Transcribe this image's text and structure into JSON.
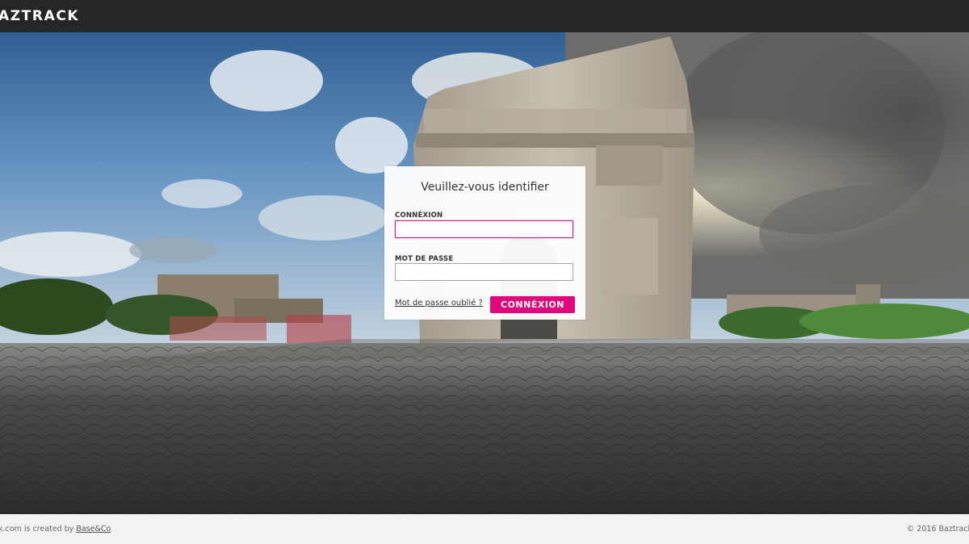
{
  "header": {
    "brand": "AZTRACK"
  },
  "login": {
    "title": "Veuillez-vous identifier",
    "username_label": "CONNÉXION",
    "username_value": "",
    "password_label": "MOT DE PASSE",
    "password_value": "",
    "forgot_link": "Mot de passe oublié ?",
    "submit_label": "CONNÉXION",
    "accent_color": "#e0077d"
  },
  "footer": {
    "left_text": "k.com is created by",
    "left_link": "Base&Co",
    "right_text": "© 2016 Baztrack"
  }
}
